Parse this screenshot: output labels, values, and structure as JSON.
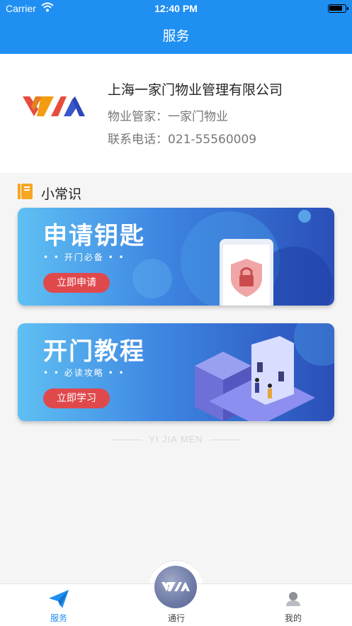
{
  "status_bar": {
    "carrier": "Carrier",
    "time": "12:40 PM"
  },
  "nav": {
    "title": "服务"
  },
  "company": {
    "name": "上海一家门物业管理有限公司",
    "manager": "物业管家：一家门物业",
    "phone": "联系电话：021-55560009"
  },
  "section": {
    "title": "小常识"
  },
  "banners": [
    {
      "headline": "申请钥匙",
      "sub": "• • 开门必备 • •",
      "cta": "立即申请"
    },
    {
      "headline": "开门教程",
      "sub": "• • 必读攻略 • •",
      "cta": "立即学习"
    }
  ],
  "watermark": "YI JIA MEN",
  "tabs": [
    {
      "label": "服务",
      "icon": "paper-plane-icon",
      "active": true
    },
    {
      "label": "通行",
      "icon": "logo-icon",
      "active": false
    },
    {
      "label": "我的",
      "icon": "user-icon",
      "active": false
    }
  ],
  "colors": {
    "primary": "#1f8ff2",
    "cta": "#e0494c",
    "section_icon": "#f5a623"
  }
}
